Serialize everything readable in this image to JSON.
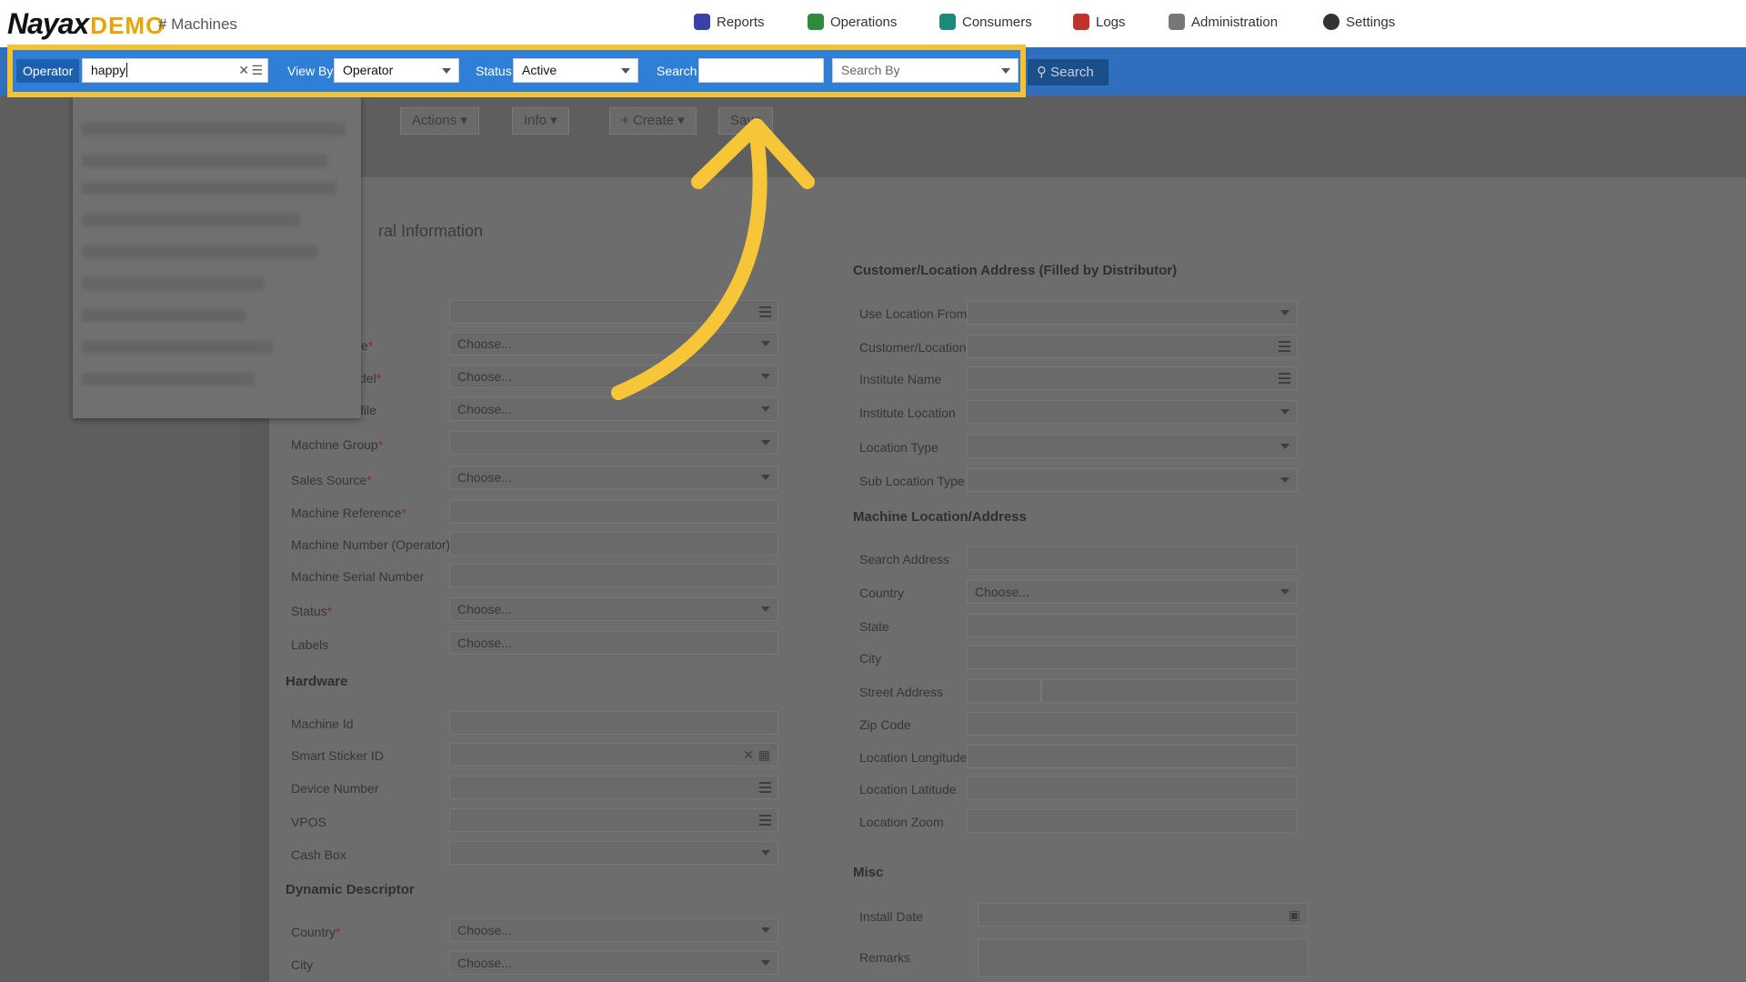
{
  "header": {
    "brand": "Nayax",
    "brand_suffix": "DEMO",
    "breadcrumb": "# Machines",
    "nav": [
      {
        "label": "Reports",
        "color": "#3b3fa8"
      },
      {
        "label": "Operations",
        "color": "#2e8b3f"
      },
      {
        "label": "Consumers",
        "color": "#1b8a7a"
      },
      {
        "label": "Logs",
        "color": "#c0322b"
      },
      {
        "label": "Administration",
        "color": "#777777"
      },
      {
        "label": "Settings",
        "color": "#333333"
      }
    ]
  },
  "filter": {
    "operator_label": "Operator",
    "operator_value": "happy",
    "viewby_label": "View By",
    "viewby_value": "Operator",
    "status_label": "Status",
    "status_value": "Active",
    "search_label": "Search",
    "search_value": "",
    "searchby_placeholder": "Search By",
    "search_button": "Search"
  },
  "toolbar": {
    "actions": "Actions",
    "info": "Info",
    "create": "+ Create",
    "save": "Save"
  },
  "general": {
    "heading": "ral Information",
    "fields": [
      {
        "label": "",
        "value": ""
      },
      {
        "label": "e",
        "value": "Choose..."
      },
      {
        "label": "del",
        "value": "Choose..."
      },
      {
        "label": "file",
        "value": "Choose..."
      },
      {
        "label": "Machine Group",
        "value": ""
      },
      {
        "label": "Sales Source",
        "value": "Choose..."
      },
      {
        "label": "Machine Reference",
        "value": ""
      },
      {
        "label": "Machine Number (Operator)",
        "value": ""
      },
      {
        "label": "Machine Serial Number",
        "value": ""
      },
      {
        "label": "Status",
        "value": "Choose..."
      },
      {
        "label": "Labels",
        "value": "Choose..."
      }
    ]
  },
  "hardware": {
    "title": "Hardware",
    "fields": [
      {
        "label": "Machine Id",
        "value": ""
      },
      {
        "label": "Smart Sticker ID",
        "value": ""
      },
      {
        "label": "Device Number",
        "value": ""
      },
      {
        "label": "VPOS",
        "value": ""
      },
      {
        "label": "Cash Box",
        "value": ""
      }
    ]
  },
  "dynamic": {
    "title": "Dynamic Descriptor",
    "fields": [
      {
        "label": "Country",
        "value": "Choose..."
      },
      {
        "label": "City",
        "value": "Choose..."
      }
    ]
  },
  "customer": {
    "title": "Customer/Location Address (Filled by Distributor)",
    "fields": [
      {
        "label": "Use Location From",
        "value": ""
      },
      {
        "label": "Customer/Location",
        "value": ""
      },
      {
        "label": "Institute Name",
        "value": ""
      },
      {
        "label": "Institute Location",
        "value": ""
      },
      {
        "label": "Location Type",
        "value": ""
      },
      {
        "label": "Sub Location Type",
        "value": ""
      }
    ]
  },
  "machine_location": {
    "title": "Machine Location/Address",
    "fields": [
      {
        "label": "Search Address",
        "value": ""
      },
      {
        "label": "Country",
        "value": "Choose..."
      },
      {
        "label": "State",
        "value": ""
      },
      {
        "label": "City",
        "value": ""
      },
      {
        "label": "Street Address",
        "value": ""
      },
      {
        "label": "Zip Code",
        "value": ""
      },
      {
        "label": "Location Longitude",
        "value": ""
      },
      {
        "label": "Location Latitude",
        "value": ""
      },
      {
        "label": "Location Zoom",
        "value": ""
      }
    ]
  },
  "misc": {
    "title": "Misc",
    "fields": [
      {
        "label": "Install Date",
        "value": ""
      },
      {
        "label": "Remarks",
        "value": ""
      }
    ]
  },
  "colors": {
    "highlight": "#f5c331",
    "filterbar": "#2f7fd6",
    "arrow": "#f6c638"
  }
}
